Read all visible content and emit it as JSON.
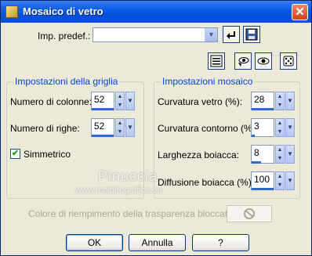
{
  "window": {
    "title": "Mosaico di vetro",
    "close_glyph": "✕"
  },
  "preset": {
    "label": "Imp. predef.:",
    "value": ""
  },
  "grid_group": {
    "title": "Impostazioni della griglia",
    "columns_label": "Numero di colonne:",
    "columns_value": "52",
    "rows_label": "Numero di righe:",
    "rows_value": "52",
    "symmetric_label": "Simmetrico",
    "symmetric_checked": true
  },
  "mosaic_group": {
    "title": "Impostazioni mosaico",
    "glass_curvature_label": "Curvatura vetro (%):",
    "glass_curvature_value": "28",
    "edge_curvature_label": "Curvatura contorno (%):",
    "edge_curvature_value": "3",
    "grout_width_label": "Larghezza boiacca:",
    "grout_width_value": "8",
    "grout_diffusion_label": "Diffusione boiacca (%):",
    "grout_diffusion_value": "100"
  },
  "watermark": {
    "line1": "Pinuccia",
    "line2": "www.maidiregrafica.eu"
  },
  "transparency": {
    "label": "Colore di riempimento della trasparenza bloccato:"
  },
  "buttons": {
    "ok": "OK",
    "cancel": "Annulla",
    "help": "?"
  }
}
